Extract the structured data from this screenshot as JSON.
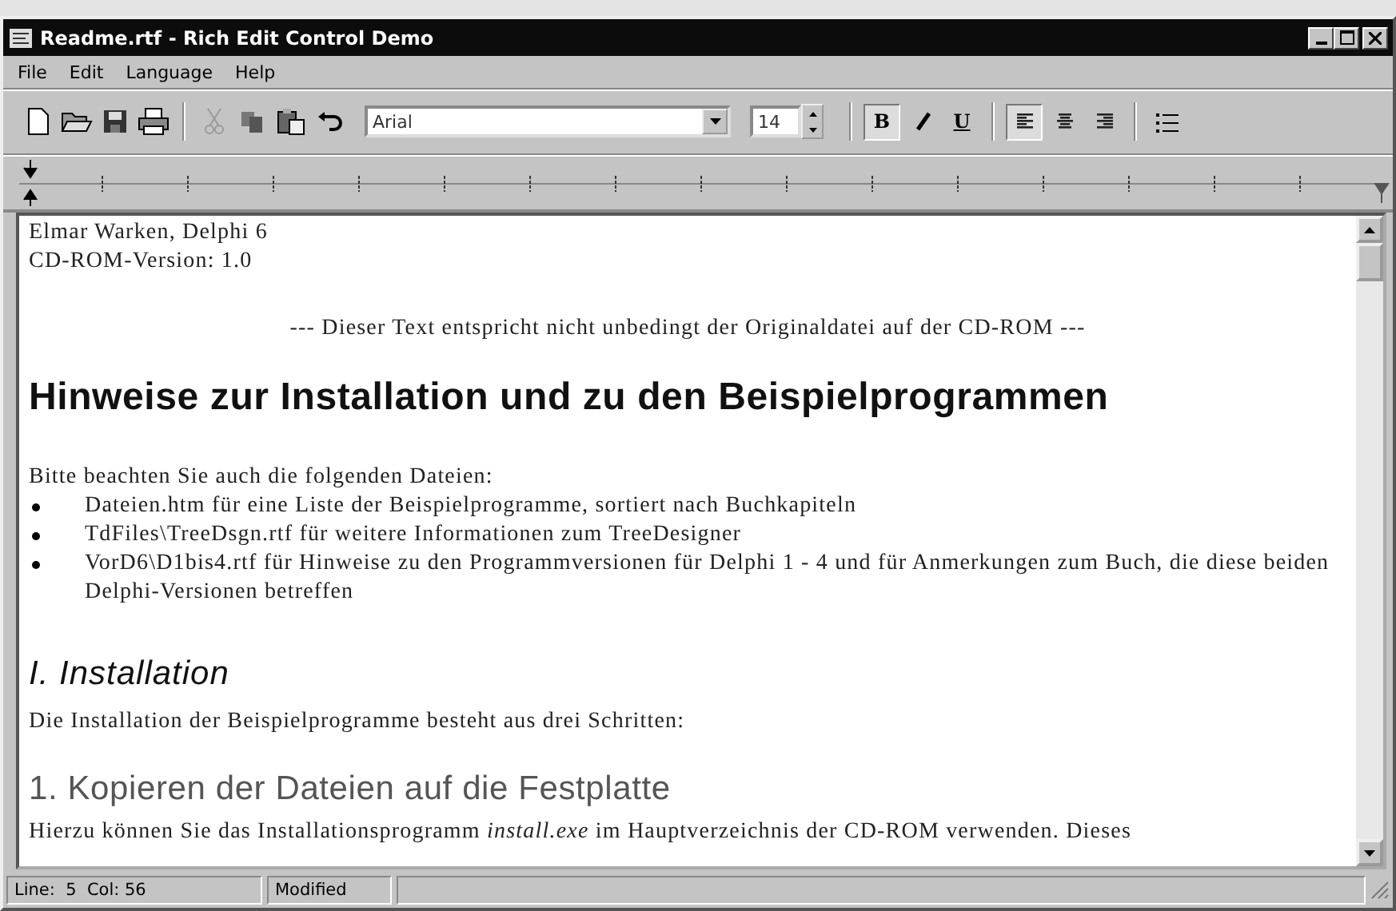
{
  "window": {
    "title": "Readme.rtf - Rich Edit Control Demo"
  },
  "menu": [
    "File",
    "Edit",
    "Language",
    "Help"
  ],
  "toolbar": {
    "font": "Arial",
    "size": "14",
    "format": [
      {
        "kind": "bold",
        "label": "B",
        "selected": true
      },
      {
        "kind": "italic",
        "selected": false
      },
      {
        "kind": "underline",
        "label": "U",
        "selected": false
      }
    ],
    "align": [
      {
        "kind": "left",
        "selected": true
      },
      {
        "kind": "center",
        "selected": false
      },
      {
        "kind": "right",
        "selected": false
      }
    ]
  },
  "document": [
    {
      "kind": "plain",
      "text": "Elmar Warken, Delphi 6"
    },
    {
      "kind": "plain",
      "text": "CD-ROM-Version: 1.0"
    },
    {
      "kind": "gap"
    },
    {
      "kind": "center",
      "text": "--- Dieser Text entspricht nicht unbedingt der Originaldatei auf der CD-ROM ---"
    },
    {
      "kind": "h1",
      "text": "Hinweise zur Installation und zu den Beispielprogrammen"
    },
    {
      "kind": "plain",
      "text": "Bitte beachten Sie auch die folgenden Dateien:"
    },
    {
      "kind": "bullet",
      "text": "Dateien.htm für eine Liste der Beispielprogramme, sortiert nach Buchkapiteln"
    },
    {
      "kind": "bullet",
      "text": "TdFiles\\TreeDsgn.rtf für weitere Informationen zum TreeDesigner"
    },
    {
      "kind": "bullet",
      "text": "VorD6\\D1bis4.rtf für Hinweise zu den Programmversionen für Delphi 1 - 4 und für Anmerkungen zum Buch, die diese beiden Delphi-Versionen betreffen"
    },
    {
      "kind": "h2",
      "text": "I. Installation"
    },
    {
      "kind": "plain",
      "text": "Die Installation der Beispielprogramme besteht aus drei Schritten:"
    },
    {
      "kind": "h3",
      "text": "1. Kopieren der Dateien auf die Festplatte"
    },
    {
      "kind": "plain",
      "text": "Hierzu können Sie das Installationsprogramm *install.exe* im Hauptverzeichnis der CD-ROM verwenden. Dieses"
    }
  ],
  "status_bar": {
    "position": "Line:  5  Col: 56",
    "state": "Modified"
  }
}
